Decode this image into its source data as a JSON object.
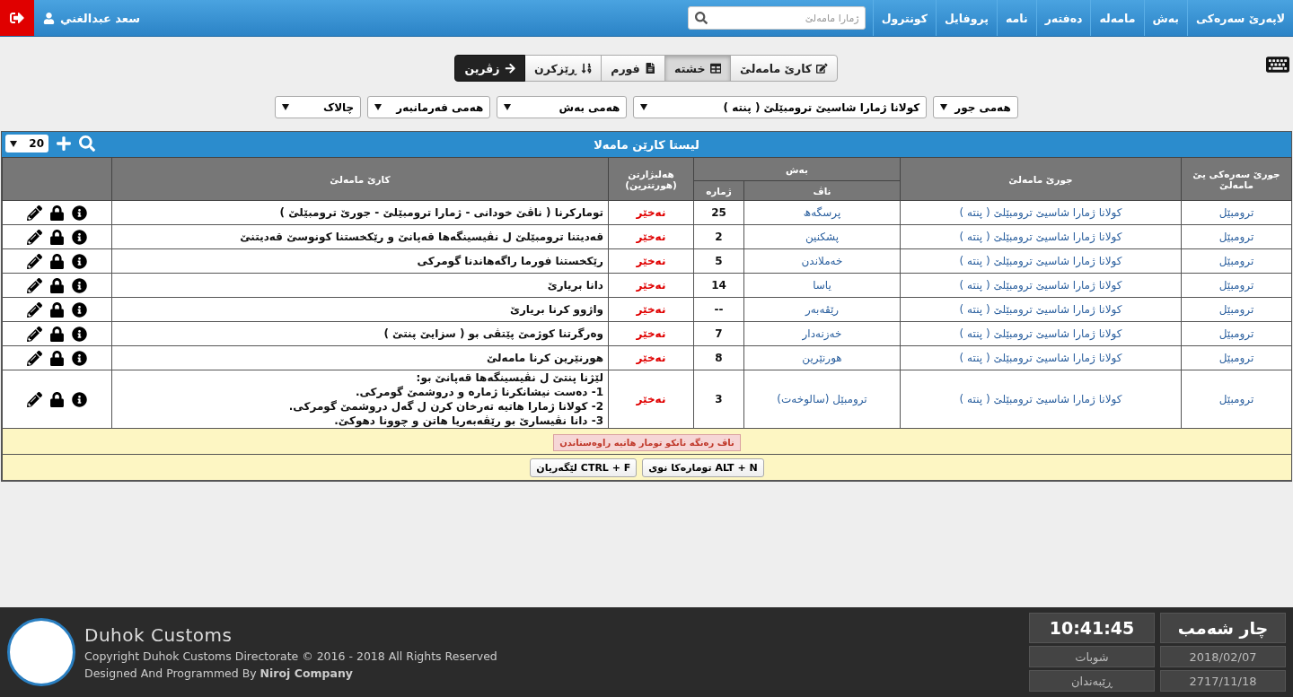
{
  "nav": {
    "items": [
      "لاپەرێ سەرەکی",
      "بەش",
      "مامەلە",
      "دەفتەر",
      "نامە",
      "پروفایل",
      "کونترول"
    ],
    "search": {
      "placeholder": "ژمارا مامەلێ"
    },
    "user": "سعد عبدالغني"
  },
  "views": [
    {
      "label": "کارێ مامەلێ",
      "selected": false
    },
    {
      "label": "خشتە",
      "selected": true
    },
    {
      "label": "فورم",
      "selected": false
    },
    {
      "label": "ڕێزکرن",
      "selected": false
    }
  ],
  "back_button": "زڤرین",
  "filters": [
    "هەمی جور",
    "کولانا ژمارا شاسیێ ترومبێلێ ( پنتە )",
    "هەمی بەش",
    "هەمی فەرمانبەر",
    "چالاک"
  ],
  "table": {
    "title": "لیستا کارێن مامەلا",
    "page_size": "20",
    "columns": {
      "main_type": "جورێ سەرەکی یێ مامەلێ",
      "type": "جورێ مامەلێ",
      "section": "بەش",
      "section_name": "ناڤ",
      "section_number": "ژمارە",
      "option": "هەلبژارتن (هورتترین)",
      "task": "کارێ مامەلێ"
    },
    "rows": [
      {
        "main_type": "ترومبێل",
        "type": "کولانا ژمارا شاسیێ ترومبێلێ ( پنتە )",
        "section_name": "پرسگەھ",
        "section_number": "25",
        "option": "نەخێر",
        "task": [
          "تومارکرنا ( ناڤێ خودانی - ژمارا ترومبێلێ - جورێ ترومبێلێ )"
        ]
      },
      {
        "main_type": "ترومبێل",
        "type": "کولانا ژمارا شاسیێ ترومبێلێ ( پنتە )",
        "section_name": "پشکنین",
        "section_number": "2",
        "option": "نەخێر",
        "task": [
          "قەدیتنا ترومبێلێ ل نڤیسینگەھا قەپانێ و رێکخستنا کونوسێ قەدیتنێ"
        ]
      },
      {
        "main_type": "ترومبێل",
        "type": "کولانا ژمارا شاسیێ ترومبێلێ ( پنتە )",
        "section_name": "خەملاندن",
        "section_number": "5",
        "option": "نەخێر",
        "task": [
          "رێکخستنا فورما راگەھاندنا گومرکی"
        ]
      },
      {
        "main_type": "ترومبێل",
        "type": "کولانا ژمارا شاسیێ ترومبێلێ ( پنتە )",
        "section_name": "یاسا",
        "section_number": "14",
        "option": "نەخێر",
        "task": [
          "دانا بریارێ"
        ]
      },
      {
        "main_type": "ترومبێل",
        "type": "کولانا ژمارا شاسیێ ترومبێلێ ( پنتە )",
        "section_name": "رێڤەبەر",
        "section_number": "--",
        "option": "نەخێر",
        "task": [
          "واژوو کرنا بریارێ"
        ]
      },
      {
        "main_type": "ترومبێل",
        "type": "کولانا ژمارا شاسیێ ترومبێلێ ( پنتە )",
        "section_name": "خەزنەدار",
        "section_number": "7",
        "option": "نەخێر",
        "task": [
          "وەرگرتنا کوژمێ پێتڤی بو ( سزایێ پنتێ )"
        ]
      },
      {
        "main_type": "ترومبێل",
        "type": "کولانا ژمارا شاسیێ ترومبێلێ ( پنتە )",
        "section_name": "هورنێرین",
        "section_number": "8",
        "option": "نەخێر",
        "task": [
          "هورنێرین کرنا مامەلێ"
        ]
      },
      {
        "main_type": "ترومبێل",
        "type": "کولانا ژمارا شاسیێ ترومبێلێ ( پنتە )",
        "section_name": "ترومبێل (سالوخەت)",
        "section_number": "3",
        "option": "نەخێر",
        "task": [
          "لێژنا پنتێ ل نڤیسینگەھا قەپانێ بو:",
          "1- دەست نیشانکرنا ژمارە و دروشمێ گومرکی.",
          "2- کولانا ژمارا هاتیە تەرخان کرن ل گەل دروشمێ گومرکی.",
          "3- دانا نڤیسارێ بو رێڤەبەریا هاتن و چوونا دهوکێ."
        ]
      }
    ],
    "legend": "ناڤ رەنگە نانکو تومار هاتیە راوەستاندن",
    "shortcuts": [
      "ALT + N تومارەکا نوی",
      "CTRL + F لێگەریان"
    ]
  },
  "footer": {
    "brand": "Duhok Customs",
    "copyright": "Copyright Duhok Customs Directorate © 2016 - 2018 All Rights Reserved",
    "credit": "Designed And Programmed By **Niroj Company**",
    "clock": [
      [
        "چار شەمب",
        "10:41:45"
      ],
      [
        "2018/02/07",
        "شوبات"
      ],
      [
        "2717/11/18",
        "ڕێبەندان"
      ]
    ]
  }
}
